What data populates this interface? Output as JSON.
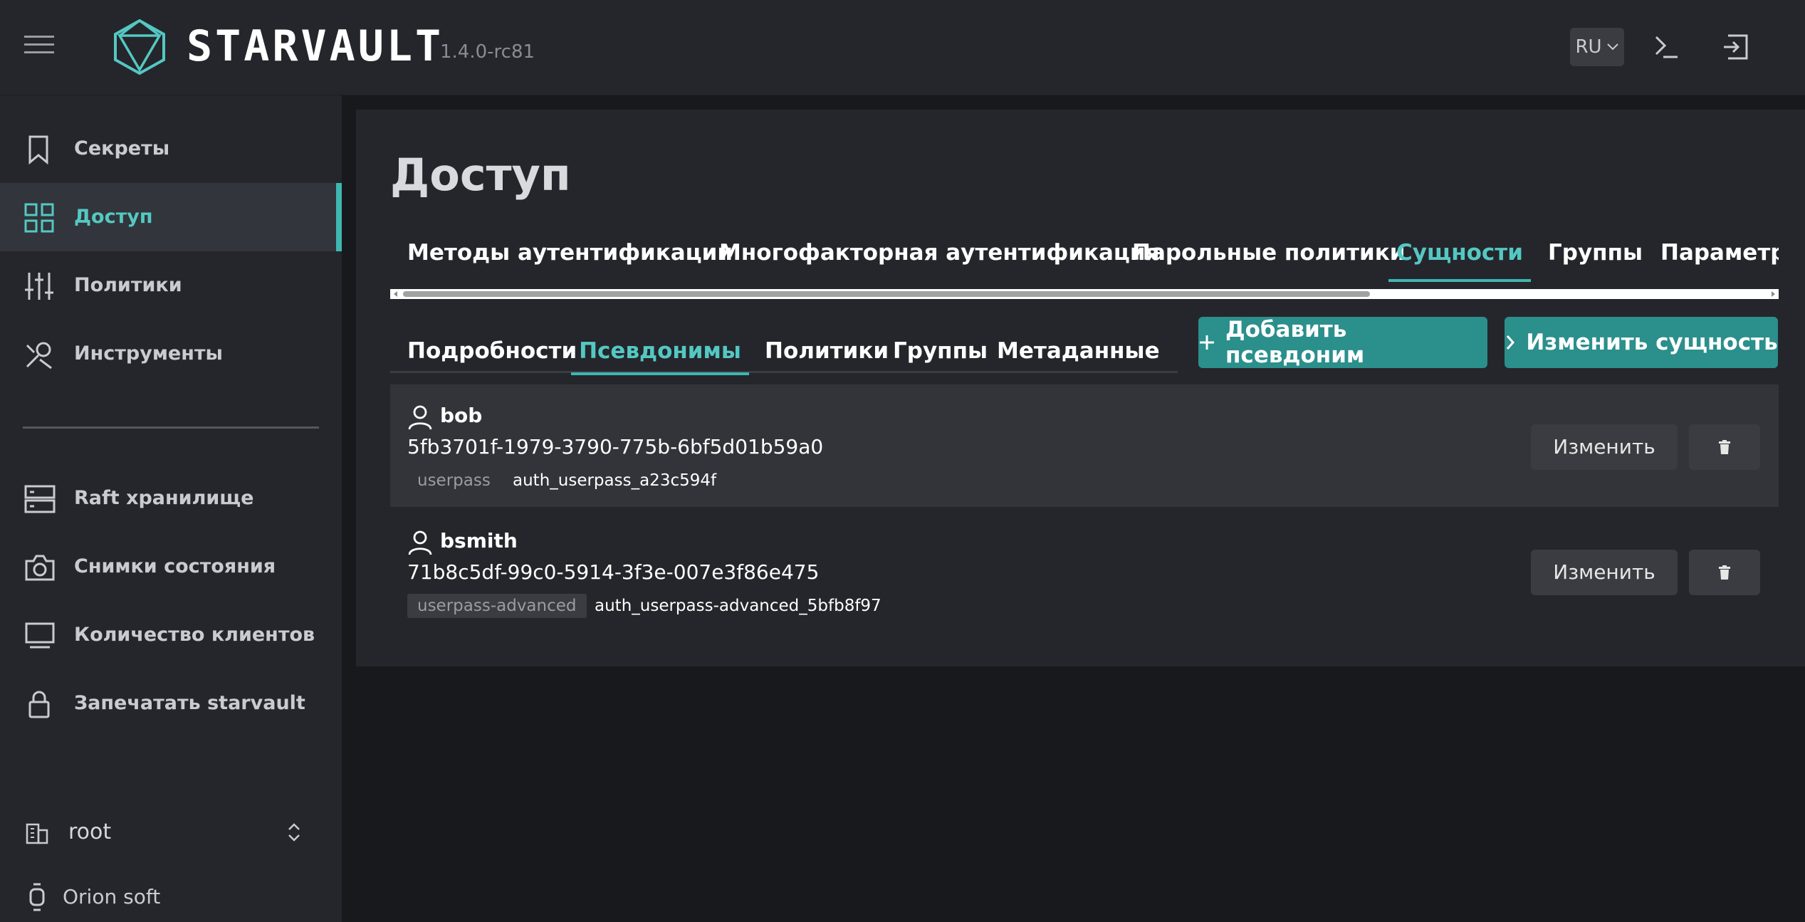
{
  "header": {
    "brand": "STARVAULT",
    "version": "1.4.0-rc81",
    "lang": "RU"
  },
  "sidebar": {
    "items": [
      {
        "label": "Секреты",
        "icon": "bookmark-icon"
      },
      {
        "label": "Доступ",
        "icon": "grid-icon"
      },
      {
        "label": "Политики",
        "icon": "sliders-icon"
      },
      {
        "label": "Инструменты",
        "icon": "tools-icon"
      }
    ],
    "bottom_items": [
      {
        "label": "Raft хранилище",
        "icon": "server-icon"
      },
      {
        "label": "Снимки состояния",
        "icon": "camera-icon"
      },
      {
        "label": "Количество клиентов",
        "icon": "monitor-icon"
      },
      {
        "label": "Запечатать starvault",
        "icon": "lock-icon"
      }
    ],
    "namespace": "root",
    "org": "Orion soft"
  },
  "main": {
    "title": "Доступ",
    "tabs": [
      "Методы аутентификации",
      "Многофакторная аутентификация",
      "Парольные политики",
      "Сущности",
      "Группы",
      "Параметры"
    ],
    "active_tab": "Сущности",
    "subtabs": [
      "Подробности",
      "Псевдонимы",
      "Политики",
      "Группы",
      "Метаданные"
    ],
    "active_subtab": "Псевдонимы",
    "add_alias_button": "Добавить псевдоним",
    "edit_entity_button": "Изменить сущность",
    "aliases": [
      {
        "name": "bob",
        "id": "5fb3701f-1979-3790-775b-6bf5d01b59a0",
        "mount_type": "userpass",
        "accessor": "auth_userpass_a23c594f",
        "edit_label": "Изменить"
      },
      {
        "name": "bsmith",
        "id": "71b8c5df-99c0-5914-3f3e-007e3f86e475",
        "mount_type": "userpass-advanced",
        "accessor": "auth_userpass-advanced_5bfb8f97",
        "edit_label": "Изменить"
      }
    ]
  },
  "colors": {
    "accent": "#3fb6b2",
    "primary_button": "#2b8f8c",
    "background": "#18191d",
    "surface": "#25262b"
  }
}
